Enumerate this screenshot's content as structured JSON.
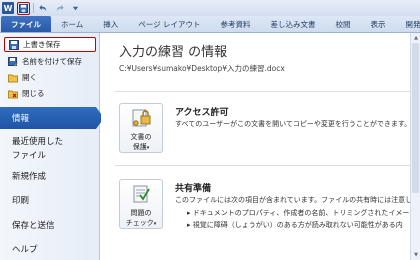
{
  "quick_access": {
    "app_icon": "W",
    "save_icon": "floppy-disk-icon",
    "undo_icon": "undo-arrow-icon",
    "redo_icon": "redo-arrow-icon",
    "customize_icon": "dropdown-chevron-icon"
  },
  "ribbon": {
    "tabs": [
      "ファイル",
      "ホーム",
      "挿入",
      "ページ レイアウト",
      "参考資料",
      "差し込み文書",
      "校閲",
      "表示",
      "開発"
    ]
  },
  "backstage": {
    "commands": [
      {
        "label": "上書き保存",
        "icon": "save-icon"
      },
      {
        "label": "名前を付けて保存",
        "icon": "save-as-icon"
      },
      {
        "label": "開く",
        "icon": "open-folder-icon"
      },
      {
        "label": "閉じる",
        "icon": "close-folder-icon"
      }
    ],
    "categories": [
      "情報",
      "最近使用した",
      "ファイル",
      "新規作成",
      "印刷",
      "保存と送信",
      "ヘルプ"
    ]
  },
  "info": {
    "title": "入力の練習 の情報",
    "path": "C:¥Users¥sumako¥Desktop¥入力の練習.docx",
    "permissions": {
      "button_line1": "文書の",
      "button_line2": "保護",
      "caret": "▾",
      "heading": "アクセス許可",
      "text": "すべてのユーザーがこの文書を開いてコピーや変更を行うことができます。"
    },
    "prepare": {
      "button_line1": "問題の",
      "button_line2": "チェック",
      "caret": "▾",
      "heading": "共有準備",
      "text": "このファイルには次の項目が含まれています。ファイルの共有時には注意し",
      "bullets": [
        "ドキュメントのプロパティ、作成者の名前、トリミングされたイメージ デ",
        "視覚に障碍（しょうがい）のある方が読み取れない可能性がある内"
      ]
    }
  },
  "colors": {
    "accent_blue": "#2f6cc0",
    "highlight_red": "#c00000"
  }
}
